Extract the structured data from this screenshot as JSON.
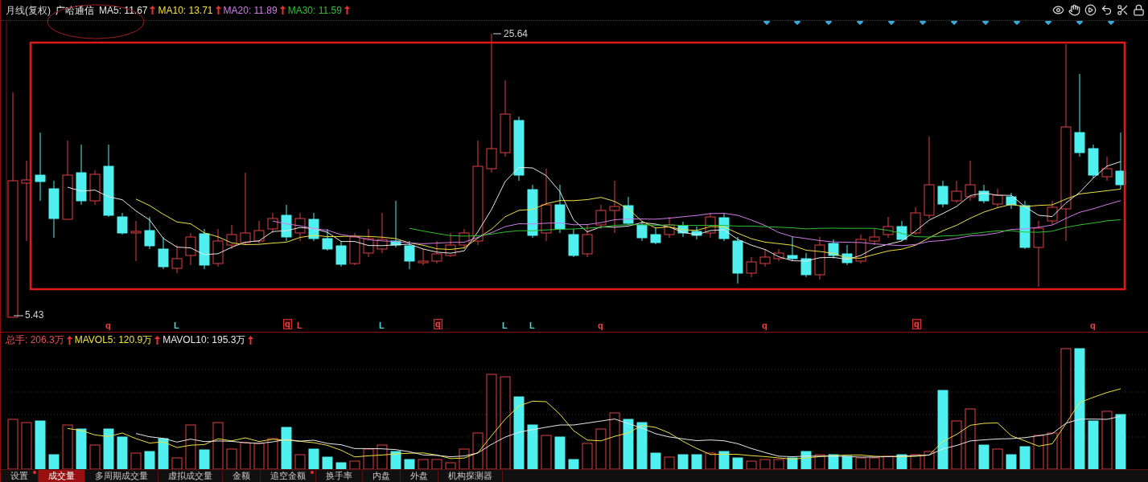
{
  "header": {
    "period": "月线(复权)",
    "stock_name": "广哈通信",
    "indicators": [
      {
        "label": "MA5: 11.67",
        "color": "#e8e8e8",
        "arrow": true
      },
      {
        "label": "MA10: 13.71",
        "color": "#f0e040",
        "arrow": true
      },
      {
        "label": "MA20: 11.89",
        "color": "#d07ce8",
        "arrow": true
      },
      {
        "label": "MA30: 11.59",
        "color": "#30c030",
        "arrow": true
      }
    ]
  },
  "price_chart": {
    "high_label": "25.64",
    "low_label": "5.43"
  },
  "signals": [
    {
      "text": "q",
      "kind": "sell"
    },
    {
      "text": "L",
      "kind": "buy"
    },
    {
      "text": "q",
      "kind": "boxed"
    },
    {
      "text": "L",
      "kind": "sell"
    },
    {
      "text": "L",
      "kind": "buy"
    },
    {
      "text": "q",
      "kind": "boxed"
    },
    {
      "text": "L",
      "kind": "buy"
    },
    {
      "text": "L",
      "kind": "buy"
    },
    {
      "text": "q",
      "kind": "sell"
    },
    {
      "text": "q",
      "kind": "sell"
    },
    {
      "text": "q",
      "kind": "boxed"
    },
    {
      "text": "q",
      "kind": "sell"
    }
  ],
  "volume_header": {
    "indicators": [
      {
        "label": "总手: 206.3万",
        "color": "#e85050",
        "arrow": true
      },
      {
        "label": "MAVOL5: 120.9万",
        "color": "#f0e040",
        "arrow": true
      },
      {
        "label": "MAVOL10: 195.3万",
        "color": "#e8e8e8",
        "arrow": true
      }
    ]
  },
  "tabs": [
    {
      "label": "设置",
      "selected": false,
      "dot": true
    },
    {
      "label": "成交量",
      "selected": true,
      "dot": false
    },
    {
      "label": "多周期成交量",
      "selected": false,
      "dot": false
    },
    {
      "label": "虚拟成交量",
      "selected": false,
      "dot": false
    },
    {
      "label": "金额",
      "selected": false,
      "dot": false
    },
    {
      "label": "追空金额",
      "selected": false,
      "dot": true
    },
    {
      "label": "换手率",
      "selected": false,
      "dot": false
    },
    {
      "label": "内盘",
      "selected": false,
      "dot": false
    },
    {
      "label": "外盘",
      "selected": false,
      "dot": false
    },
    {
      "label": "机构探测器",
      "selected": false,
      "dot": false
    }
  ]
}
